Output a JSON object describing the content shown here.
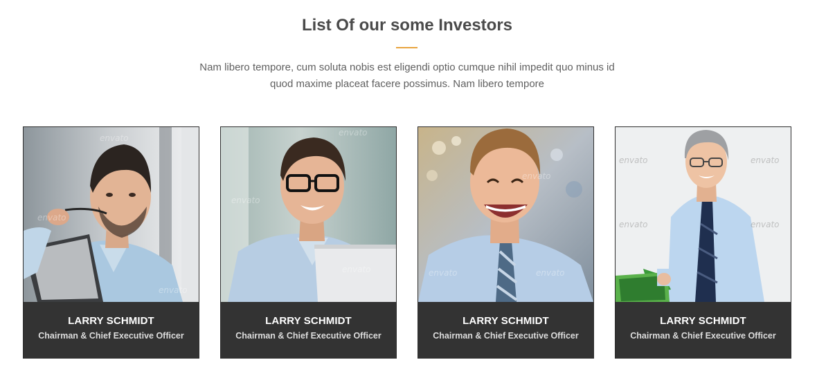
{
  "section": {
    "title": "List Of our some Investors",
    "intro_line1": "Nam libero tempore, cum soluta nobis est eligendi optio cumque nihil impedit quo minus id",
    "intro_line2": "quod maxime placeat facere possimus. Nam libero tempore",
    "accent_color": "#e8a33d"
  },
  "investors": [
    {
      "name": "LARRY SCHMIDT",
      "role": "Chairman & Chief Executive Officer",
      "photo": "man-with-tablet-photo"
    },
    {
      "name": "LARRY SCHMIDT",
      "role": "Chairman & Chief Executive Officer",
      "photo": "man-with-glasses-laptop-photo"
    },
    {
      "name": "LARRY SCHMIDT",
      "role": "Chairman & Chief Executive Officer",
      "photo": "laughing-man-photo"
    },
    {
      "name": "LARRY SCHMIDT",
      "role": "Chairman & Chief Executive Officer",
      "photo": "gray-haired-man-calculator-photo"
    }
  ],
  "watermark_text": "envato"
}
